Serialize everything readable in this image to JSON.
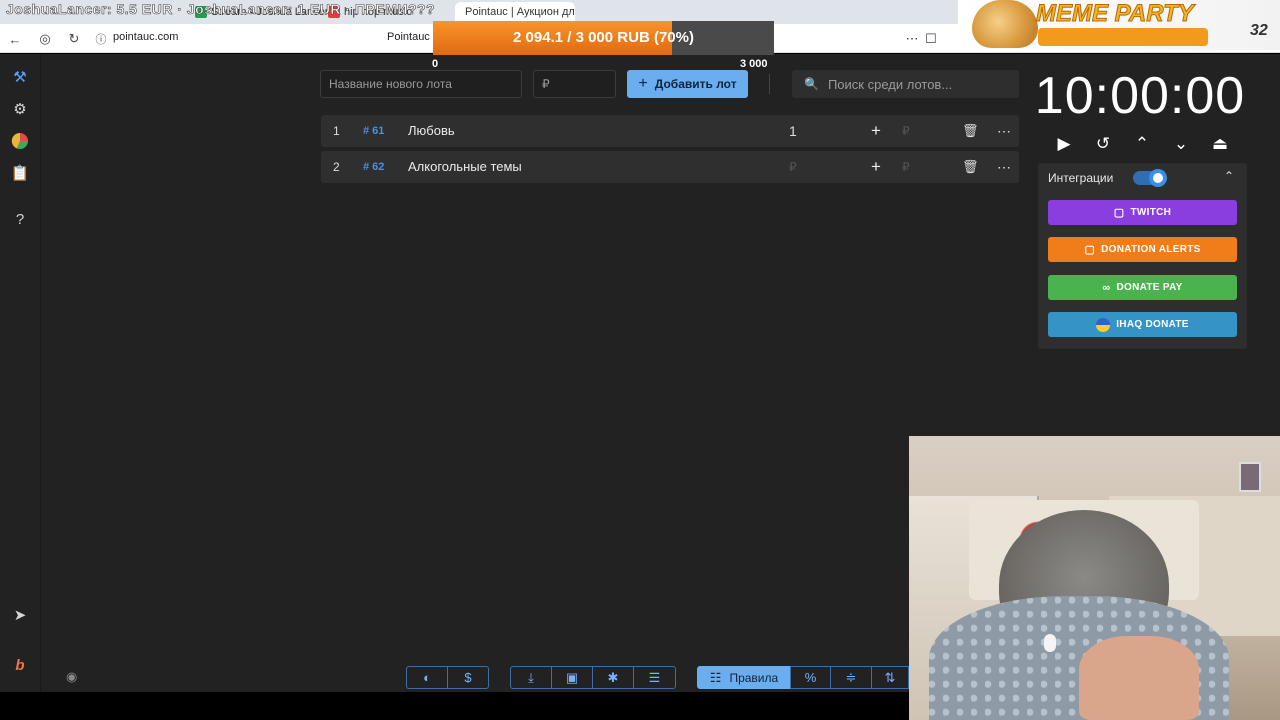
{
  "browser": {
    "tabs": [
      {
        "label": "Stream - Joshua Lancer",
        "icon_color": "#1aa34a"
      },
      {
        "label": "hip hop music",
        "icon_color": "#e23b3b"
      },
      {
        "label": "Pointauc | Аукцион для...",
        "icon_color": "#4aa3df"
      }
    ],
    "url": "pointauc.com",
    "page_title": "Pointauc |"
  },
  "stream_overlay": {
    "donation_ticker": "JoshuaLancer: 5.5 EUR · JoshuaLancer: 1 EUR · ПРЕМИ???",
    "goal": {
      "text": "2 094.1 / 3 000 RUB (70%)",
      "progress": 0.7,
      "min": "0",
      "max": "3 000"
    },
    "meme_party": {
      "title": "MEME PARTY",
      "count": "32"
    }
  },
  "sidebar": {
    "items": [
      {
        "name": "auction-icon"
      },
      {
        "name": "gear-icon"
      },
      {
        "name": "pie-chart-icon"
      },
      {
        "name": "clipboard-icon"
      },
      {
        "name": "help-icon"
      }
    ],
    "bottom_items": [
      {
        "name": "telegram-icon"
      },
      {
        "name": "boosty-icon"
      }
    ]
  },
  "toolbar": {
    "new_lot_placeholder": "Название нового лота",
    "amount_placeholder": "₽",
    "add_lot_label": "Добавить лот",
    "search_placeholder": "Поиск среди лотов..."
  },
  "lots": [
    {
      "index": "1",
      "tag": "# 61",
      "name": "Любовь",
      "amount": "1",
      "currency": "₽"
    },
    {
      "index": "2",
      "tag": "# 62",
      "name": "Алкогольные темы",
      "amount": "₽",
      "currency": "₽"
    }
  ],
  "timer": {
    "value": "10:00:00"
  },
  "integrations": {
    "label": "Интеграции",
    "enabled": true,
    "buttons": [
      {
        "label": "TWITCH",
        "color": "#8a3ee0"
      },
      {
        "label": "DONATION ALERTS",
        "color": "#f07d1a"
      },
      {
        "label": "DONATE PAY",
        "color": "#4ab34e"
      },
      {
        "label": "IHAQ DONATE",
        "color": "#3593c6"
      }
    ]
  },
  "bottom_toolbar": {
    "rules_label": "Правила"
  },
  "colors": {
    "accent": "#6aaeef",
    "background": "#222222",
    "row": "#2f2f2f"
  }
}
